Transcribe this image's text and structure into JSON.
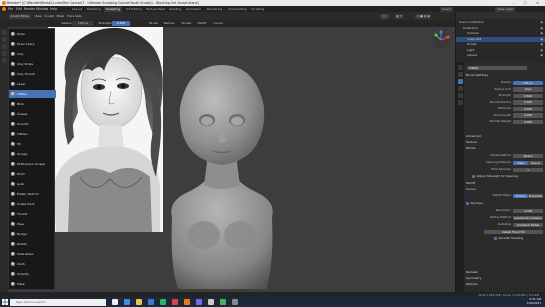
{
  "window": {
    "title": "Blender* [C:\\Blender\\Rental\\1.com\\Rev Course\\7 - Ultimate Sculpting Course\\Youth Sculpt\\1 - Blocking Out Sculpt.blend]"
  },
  "menu": {
    "items": [
      "File",
      "Edit",
      "Render",
      "Window",
      "Help"
    ],
    "workspaces": [
      "Layout",
      "Modeling",
      "Sculpting",
      "UV Editing",
      "Texture Paint",
      "Shading",
      "Animation",
      "Rendering",
      "Compositing",
      "Scripting"
    ],
    "active_workspace": "Sculpting",
    "scene_label": "Scene",
    "view_layer_label": "View Layer"
  },
  "header": {
    "mode": "Sculpt Mode",
    "view": "View",
    "sculpt": "Sculpt",
    "mask": "Mask",
    "face_sets": "Face Sets"
  },
  "toolheader": {
    "brush": "Inflate",
    "radius_label": "Radius",
    "radius_value": "103 px",
    "strength_label": "Strength",
    "strength_value": "0.500",
    "brush_label": "Brush",
    "texture_label": "Texture",
    "stroke_label": "Stroke",
    "falloff_label": "Falloff",
    "cursor_label": "Cursor"
  },
  "brush_menu": {
    "active": "Inflate",
    "items": [
      "Draw",
      "Draw Sharp",
      "Clay",
      "Clay Strips",
      "Clay Thumb",
      "Layer",
      "Inflate",
      "Blob",
      "Crease",
      "Smooth",
      "Flatten",
      "Fill",
      "Scrape",
      "Multi-plane Scrape",
      "Pinch",
      "Grab",
      "Elastic Deform",
      "Snake Hook",
      "Thumb",
      "Pose",
      "Nudge",
      "Rotate",
      "Slide Relax",
      "Cloth",
      "Simplify",
      "Mask"
    ]
  },
  "outliner": {
    "header": "Scene Collection",
    "rows": [
      {
        "label": "Scene Collection",
        "indent": 0,
        "sel": false
      },
      {
        "label": "Collection",
        "indent": 1,
        "sel": false
      },
      {
        "label": "Camera",
        "indent": 2,
        "sel": false
      },
      {
        "label": "Cube.001",
        "indent": 2,
        "sel": true
      },
      {
        "label": "Empty",
        "indent": 2,
        "sel": false
      },
      {
        "label": "Light",
        "indent": 2,
        "sel": false
      },
      {
        "label": "sphere",
        "indent": 2,
        "sel": false
      }
    ]
  },
  "props": {
    "brush_name": "Inflate",
    "sections": {
      "brush_settings": "Brush Settings",
      "advanced": "Advanced",
      "texture": "Texture",
      "stroke": "Stroke",
      "falloff": "Falloff",
      "cursor": "Cursor",
      "dyntopo": "Dyntopo",
      "remesh": "Remesh",
      "symmetry": "Symmetry",
      "options": "Options",
      "workspace": "Workspace"
    },
    "rows": [
      {
        "label": "Radius",
        "value": "103 px"
      },
      {
        "label": "Radius Unit",
        "value": "View"
      },
      {
        "label": "Strength",
        "value": "0.500"
      },
      {
        "label": "Normal Radius",
        "value": "0.500"
      },
      {
        "label": "Hardness",
        "value": "0.000"
      },
      {
        "label": "Autosmooth",
        "value": "0.000"
      },
      {
        "label": "Normal Weight",
        "value": "0.000"
      }
    ],
    "stroke_method_label": "Stroke Method",
    "stroke_method": "Space",
    "spacing_label": "Spacing Distance",
    "spacing": "View",
    "spacing_value": "Scene",
    "total_samples_label": "Total Samples",
    "total_samples": "1",
    "adjust_strength": "Adjust Strength for Spacing",
    "dash_ratio": "Stabilize Stroke",
    "falloff_shape_label": "Falloff Shape",
    "falloff_shape_a": "Sphere",
    "falloff_shape_b": "Projected",
    "resolution_label": "Resolution",
    "resolution": "12.00",
    "refine_label": "Refine Method",
    "refine": "Subdivide Collapse",
    "detailing_label": "Detailing",
    "detailing": "Constant Detail",
    "detail_flood": "Detail Flood Fill",
    "smooth_shading": "Smooth Shading",
    "area_normal": "Area Normal",
    "front_faces": "Front Faces Only"
  },
  "statusbar": {
    "stats": "Verts 5,044,356 | Faces 3,116,904 | 3.2 GiB"
  },
  "taskbar": {
    "search_placeholder": "Type here to search",
    "time": "9:31 AM",
    "date": "3/28/2021"
  },
  "colors": {
    "accent": "#4772b3",
    "selected_row": "#334d80",
    "viewport_bg": "#3d3d3d"
  }
}
